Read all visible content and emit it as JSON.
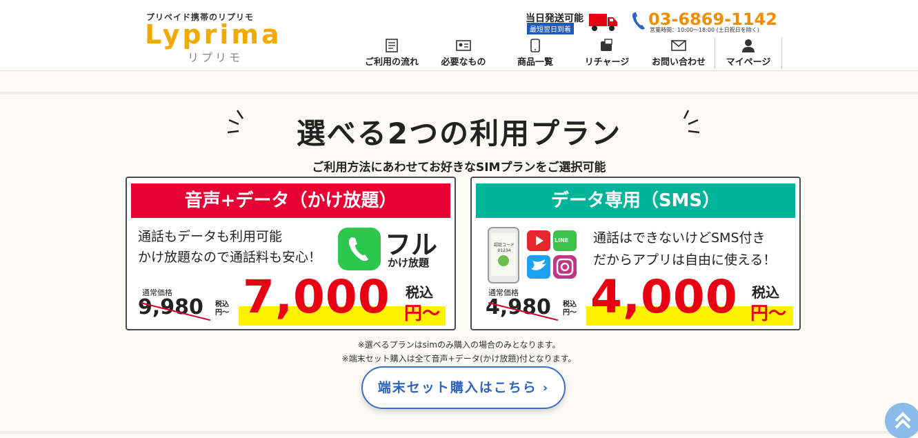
{
  "header": {
    "logo_tagline": "プリペイド携帯のリプリモ",
    "logo_word": "Lyprima",
    "logo_kana": "リプリモ",
    "shipping_title": "当日発送可能",
    "shipping_sub": "最短翌日到着",
    "phone_number": "03-6869-1142",
    "phone_hours": "営業時間：10:00～18:00 (土日祝日を除く)",
    "accent_color": "#f2a900"
  },
  "nav": {
    "items": [
      {
        "label": "ご利用の流れ",
        "icon": "document-icon"
      },
      {
        "label": "必要なもの",
        "icon": "id-card-icon"
      },
      {
        "label": "商品一覧",
        "icon": "smartphone-icon"
      },
      {
        "label": "リチャージ",
        "icon": "recharge-icon"
      },
      {
        "label": "お問い合わせ",
        "icon": "mail-icon"
      },
      {
        "label": "マイページ",
        "icon": "user-icon"
      }
    ]
  },
  "main": {
    "headline": "選べる2つの利用プラン",
    "subheadline": "ご利用方法にあわせてお好きなSIMプランをご選択可能",
    "plans": [
      {
        "title": "音声+データ（かけ放題）",
        "color": "#e60033",
        "desc_line1": "通話もデータも利用可能",
        "desc_line2": "かけ放題なので通話料も安心！",
        "badge_main": "フル",
        "badge_sub": "かけ放題",
        "regular_label": "通常価格",
        "regular_price": "9,980",
        "regular_tax_1": "税込",
        "regular_tax_2": "円〜",
        "price": "7,000",
        "tax_label": "税込",
        "yen_label": "円〜"
      },
      {
        "title": "データ専用（SMS）",
        "color": "#00b49a",
        "desc_line1": "通話はできないけどSMS付き",
        "desc_line2": "だからアプリは自由に使える！",
        "phone_screen_code": "認証コード 01234",
        "line_label": "LINE",
        "regular_label": "通常価格",
        "regular_price": "4,980",
        "regular_tax_1": "税込",
        "regular_tax_2": "円〜",
        "price": "4,000",
        "tax_label": "税込",
        "yen_label": "円〜"
      }
    ],
    "note1": "※選べるプランはsimのみ購入の場合のみとなります。",
    "note2": "※端末セット購入は全て音声+データ(かけ放題)付となります。",
    "cta_label": "端末セット購入はこちら",
    "cta_chevron": "›"
  }
}
